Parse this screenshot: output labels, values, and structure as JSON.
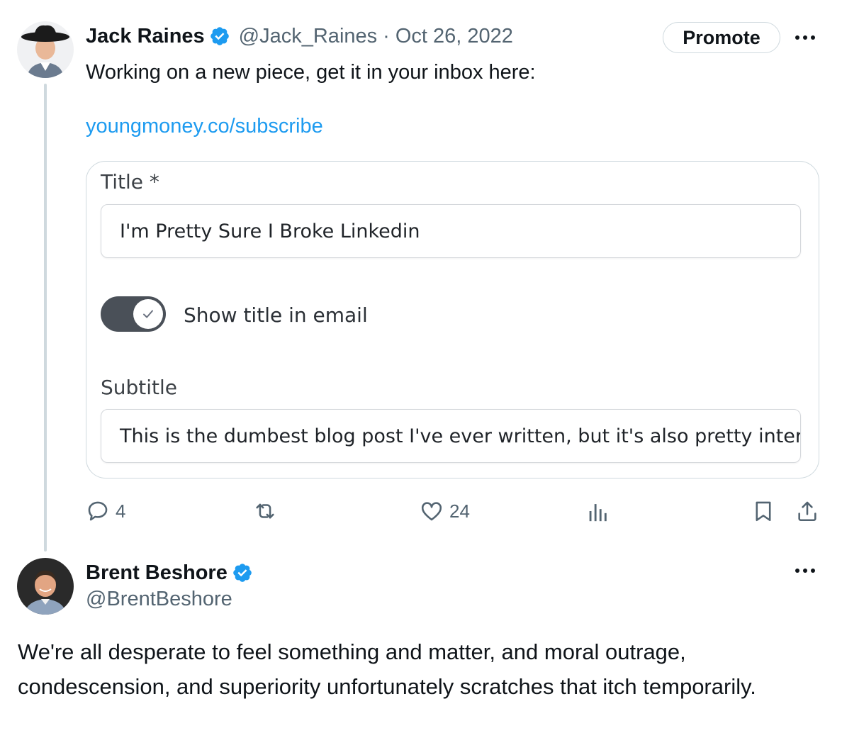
{
  "tweet": {
    "author_name": "Jack Raines",
    "handle": "@Jack_Raines",
    "date_separator": "·",
    "date": "Oct 26, 2022",
    "promote_label": "Promote",
    "text": "Working on a new piece, get it in your inbox here:",
    "link": "youngmoney.co/subscribe",
    "embedded_form": {
      "title_label": "Title *",
      "title_value": "I'm Pretty Sure I Broke Linkedin",
      "toggle_label": "Show title in email",
      "toggle_on": true,
      "subtitle_label": "Subtitle",
      "subtitle_value": "This is the dumbest blog post I've ever written, but it's also pretty interesting"
    },
    "actions": {
      "reply_count": "4",
      "retweet_count": "",
      "like_count": "24"
    }
  },
  "reply": {
    "author_name": "Brent Beshore",
    "handle": "@BrentBeshore",
    "text": "We're all desperate to feel something and matter, and moral outrage, condescension, and superiority unfortunately scratches that itch temporarily."
  },
  "colors": {
    "verified_blue": "#1d9bf0",
    "link_blue": "#1d9bf0",
    "muted_text": "#536471",
    "toggle_bg": "#4a5058"
  },
  "icons": [
    "verified-badge-icon",
    "more-icon",
    "reply-icon",
    "retweet-icon",
    "like-icon",
    "views-icon",
    "bookmark-icon",
    "share-icon",
    "checkmark-icon"
  ]
}
